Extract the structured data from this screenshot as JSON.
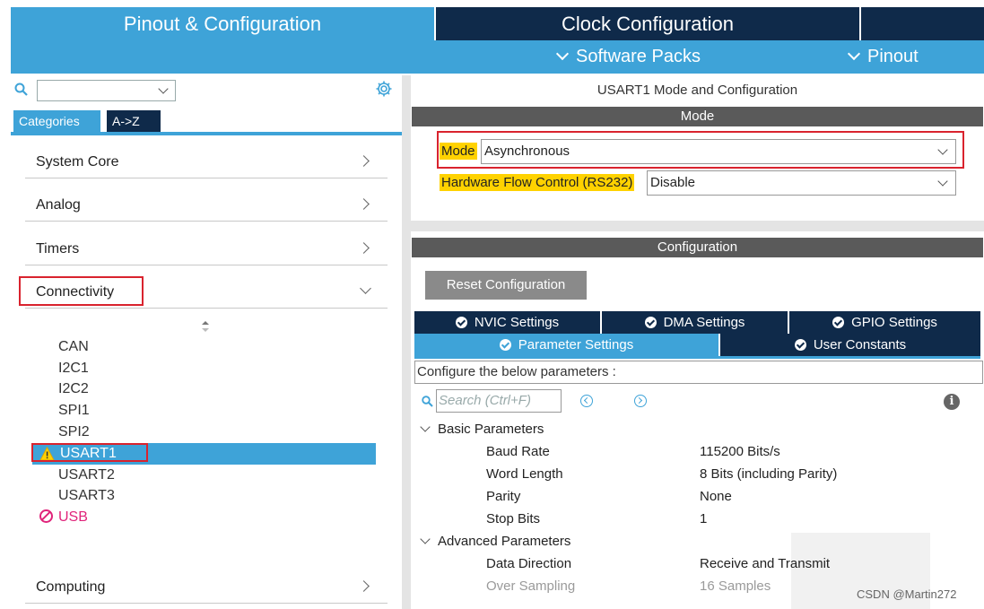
{
  "top_tabs": {
    "pinout": "Pinout & Configuration",
    "clock": "Clock Configuration"
  },
  "subnav": {
    "software_packs": "Software Packs",
    "pinout": "Pinout"
  },
  "left": {
    "tabs": {
      "categories": "Categories",
      "az": "A->Z"
    },
    "categories": [
      {
        "label": "System Core",
        "state": "collapsed"
      },
      {
        "label": "Analog",
        "state": "collapsed"
      },
      {
        "label": "Timers",
        "state": "collapsed"
      },
      {
        "label": "Connectivity",
        "state": "expanded"
      },
      {
        "label": "Computing",
        "state": "collapsed"
      }
    ],
    "peripherals": [
      {
        "label": "CAN"
      },
      {
        "label": "I2C1"
      },
      {
        "label": "I2C2"
      },
      {
        "label": "SPI1"
      },
      {
        "label": "SPI2"
      },
      {
        "label": "USART1",
        "selected": true,
        "status": "warning"
      },
      {
        "label": "USART2"
      },
      {
        "label": "USART3"
      },
      {
        "label": "USB",
        "status": "disabled"
      }
    ]
  },
  "right": {
    "title": "USART1 Mode and Configuration",
    "mode_section": "Mode",
    "mode": {
      "label": "Mode",
      "value": "Asynchronous"
    },
    "hw_flow": {
      "label": "Hardware Flow Control (RS232)",
      "value": "Disable"
    },
    "config_section": "Configuration",
    "reset_button": "Reset Configuration",
    "tabs_row1": [
      "NVIC Settings",
      "DMA Settings",
      "GPIO Settings"
    ],
    "tabs_row2": [
      "Parameter Settings",
      "User Constants"
    ],
    "hint": "Configure the below parameters :",
    "search_placeholder": "Search (Ctrl+F)",
    "info_glyph": "i",
    "groups": [
      {
        "name": "Basic Parameters",
        "params": [
          {
            "name": "Baud Rate",
            "value": "115200 Bits/s"
          },
          {
            "name": "Word Length",
            "value": "8 Bits (including Parity)"
          },
          {
            "name": "Parity",
            "value": "None"
          },
          {
            "name": "Stop Bits",
            "value": "1"
          }
        ]
      },
      {
        "name": "Advanced Parameters",
        "params": [
          {
            "name": "Data Direction",
            "value": "Receive and Transmit"
          },
          {
            "name": "Over Sampling",
            "value": "16 Samples",
            "disabled": true
          }
        ]
      }
    ]
  },
  "watermark": "CSDN @Martin272",
  "colors": {
    "accent_blue": "#3ea3d8",
    "navy": "#0f2a4a",
    "highlight_yellow": "#ffd200",
    "annotation_red": "#d9232e",
    "usb_pink": "#e0237a"
  }
}
